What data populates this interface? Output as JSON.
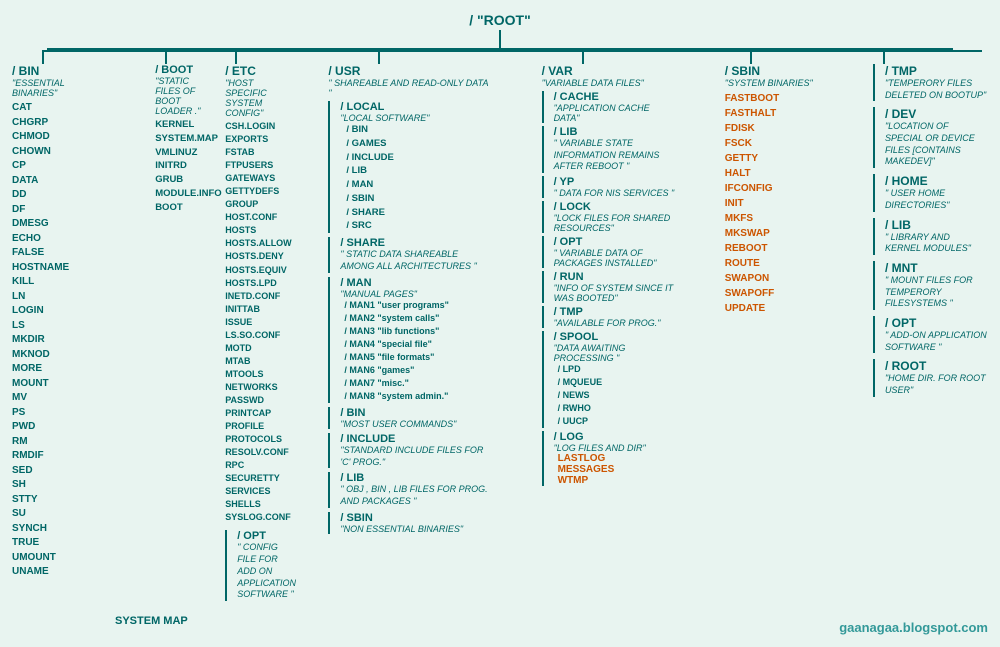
{
  "root": {
    "label": "/",
    "name": "\"ROOT\""
  },
  "watermark": "gaanagaa.blogspot.com",
  "columns": {
    "bin": {
      "title": "/ BIN",
      "desc": "\"ESSENTIAL BINARIES\"",
      "files": [
        "CAT",
        "CHGRP",
        "CHMOD",
        "CHOWN",
        "CP",
        "DATA",
        "DD",
        "DF",
        "DMESG",
        "ECHO",
        "FALSE",
        "HOSTNAME",
        "KILL",
        "LN",
        "LOGIN",
        "LS",
        "MKDIR",
        "MKNOD",
        "MORE",
        "MOUNT",
        "MV",
        "PS",
        "PWD",
        "RM",
        "RMDIF",
        "SED",
        "SH",
        "STTY",
        "SU",
        "SYNCH",
        "TRUE",
        "UMOUNT",
        "UNAME"
      ]
    },
    "etc": {
      "title": "/ ETC",
      "desc": "\"HOST SPECIFIC SYSTEM CONFIG\"",
      "files": [
        "CSH.LOGIN",
        "EXPORTS",
        "FSTAB",
        "FTPUSERS",
        "GATEWAYS",
        "GETTYDEFS",
        "GROUP",
        "HOST.CONF",
        "HOSTS",
        "HOSTS.ALLOW",
        "HOSTS.DENY",
        "HOSTS.EQUIV",
        "HOSTS.LPD",
        "INETD.CONF",
        "INITTAB",
        "ISSUE",
        "LS.SO.CONF",
        "MOTD",
        "MTAB",
        "MTOOLS",
        "NETWORKS",
        "PASSWD",
        "PRINTCAP",
        "PROFILE",
        "PROTOCOLS",
        "RESOLV.CONF",
        "RPC",
        "SECURETTY",
        "SERVICES",
        "SHELLS",
        "SYSLOG.CONF"
      ],
      "opt": {
        "title": "/ OPT",
        "desc": "\" CONFIG FILE FOR ADD ON APPLICATION SOFTWARE \""
      }
    },
    "boot": {
      "title": "/ BOOT",
      "desc": "\"STATIC FILES OF BOOT LOADER .\"",
      "files": [
        "KERNEL",
        "SYSTEM.MAP",
        "VMLINUZ",
        "INITRD",
        "GRUB",
        "MODULE.INFO",
        "BOOT"
      ]
    },
    "usr": {
      "title": "/ USR",
      "desc": "\" SHAREABLE AND READ-ONLY DATA \"",
      "local": {
        "title": "/ LOCAL",
        "desc": "\"LOCAL SOFTWARE\"",
        "subdirs": [
          "/ BIN",
          "/ GAMES",
          "/ INCLUDE",
          "/ LIB",
          "/ MAN",
          "/ SBIN",
          "/ SHARE",
          "/ SRC"
        ]
      },
      "share": {
        "title": "/ SHARE",
        "desc": "\" STATIC DATA SHAREABLE AMONG ALL ARCHITECTURES \""
      },
      "man": {
        "title": "/ MAN",
        "desc": "\"MANUAL PAGES\"",
        "subdirs": [
          "/ MAN1 \"user programs\"",
          "/ MAN2 \"system calls\"",
          "/ MAN3 \"lib functions\"",
          "/ MAN4 \"special file\"",
          "/ MAN5 \"file formats\"",
          "/ MAN6 \"games\"",
          "/ MAN7 \"misc.\"",
          "/ MAN8 \"system admin.\""
        ]
      },
      "bin": {
        "title": "/ BIN",
        "desc": "\"MOST USER COMMANDS\""
      },
      "include": {
        "title": "/ INCLUDE",
        "desc": "\"STANDARD INCLUDE FILES FOR 'C' PROG.\""
      },
      "lib": {
        "title": "/ LIB",
        "desc": "\" OBJ , BIN , LIB FILES FOR PROG. AND PACKAGES \""
      },
      "sbin": {
        "title": "/ SBIN",
        "desc": "\"NON ESSENTIAL BINARIES\""
      }
    },
    "var": {
      "title": "/ VAR",
      "desc": "\"VARIABLE DATA FILES\"",
      "cache": {
        "title": "/ CACHE",
        "desc": "\"APPLICATION CACHE DATA\""
      },
      "lib": {
        "title": "/ LIB",
        "desc": "\" VARIABLE STATE INFORMATION REMAINS AFTER REBOOT \""
      },
      "yp": {
        "title": "/ YP",
        "desc": "\" DATA FOR NIS SERVICES \""
      },
      "lock": {
        "title": "/ LOCK",
        "desc": "\"LOCK FILES FOR SHARED RESOURCES\""
      },
      "opt": {
        "title": "/ OPT",
        "desc": "\" VARIABLE DATA OF PACKAGES INSTALLED\""
      },
      "run": {
        "title": "/ RUN",
        "desc": "\"INFO OF SYSTEM SINCE IT WAS BOOTED\""
      },
      "tmp": {
        "title": "/ TMP",
        "desc": "\"AVAILABLE FOR PROG.\""
      },
      "spool": {
        "title": "/ SPOOL",
        "desc": "\"DATA AWAITING PROCESSING \"",
        "subdirs": [
          "/ LPD",
          "/ MQUEUE",
          "/ NEWS",
          "/ RWHO",
          "/ UUCP"
        ]
      },
      "log": {
        "title": "/ LOG",
        "desc": "\"LOG FILES AND DIR\"",
        "files_orange": [
          "LASTLOG",
          "MESSAGES",
          "WTMP"
        ]
      }
    },
    "sbin": {
      "title": "/ SBIN",
      "desc": "\"SYSTEM BINARIES\"",
      "files_orange": [
        "FASTBOOT",
        "FASTHALT",
        "FDISK",
        "FSCK",
        "GETTY",
        "HALT",
        "IFCONFIG",
        "INIT",
        "MKFS",
        "MKSWAP",
        "REBOOT",
        "ROUTE",
        "SWAPON",
        "SWAPOFF",
        "UPDATE"
      ]
    },
    "right": {
      "tmp": {
        "title": "/ TMP",
        "desc": "\"TEMPERORY FILES DELETED ON BOOTUP\""
      },
      "dev": {
        "title": "/ DEV",
        "desc": "\"LOCATION OF SPECIAL OR DEVICE FILES [CONTAINS MAKEDEV]\""
      },
      "home": {
        "title": "/ HOME",
        "desc": "\" USER HOME DIRECTORIES\""
      },
      "lib": {
        "title": "/ LIB",
        "desc": "\"  LIBRARY AND KERNEL MODULES\""
      },
      "mnt": {
        "title": "/ MNT",
        "desc": "\"  MOUNT FILES FOR TEMPERORY FILESYSTEMS \""
      },
      "opt": {
        "title": "/ OPT",
        "desc": "\"  ADD-ON APPLICATION SOFTWARE \""
      },
      "root": {
        "title": "/ ROOT",
        "desc": "\"HOME DIR. FOR ROOT USER\""
      }
    }
  }
}
